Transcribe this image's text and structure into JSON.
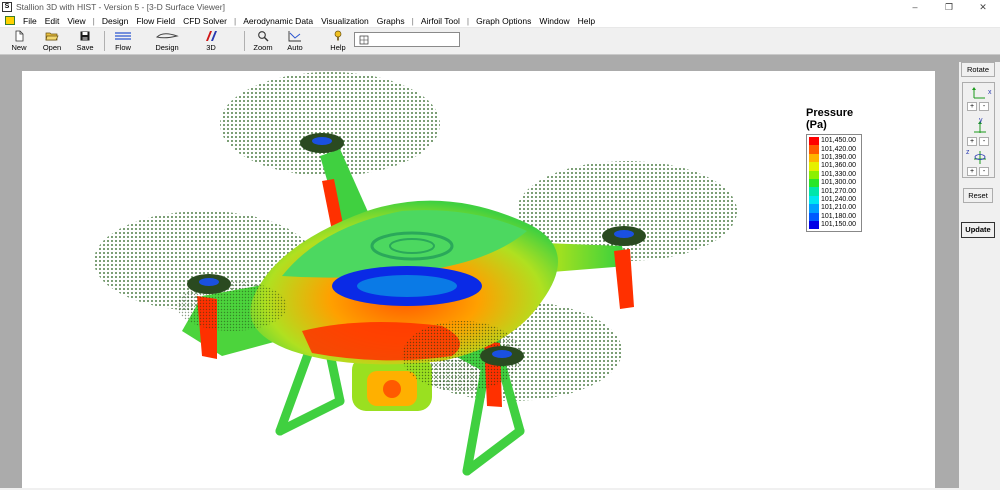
{
  "window": {
    "title": "Stallion 3D with HIST - Version 5 - [3-D Surface Viewer]",
    "minimize": "–",
    "restore": "❐",
    "close": "✕"
  },
  "menu": {
    "items": [
      "File",
      "Edit",
      "View",
      "|",
      "Design",
      "Flow Field",
      "CFD Solver",
      "|",
      "Aerodynamic Data",
      "Visualization",
      "Graphs",
      "|",
      "Airfoil Tool",
      "|",
      "Graph Options",
      "Window",
      "Help"
    ]
  },
  "toolbar": {
    "new_label": "New",
    "open_label": "Open",
    "save_label": "Save",
    "flow_label": "Flow",
    "design_label": "Design",
    "threed_label": "3D",
    "zoom_label": "Zoom",
    "auto_label": "Auto",
    "help_label": "Help"
  },
  "side_panel": {
    "rotate_label": "Rotate",
    "x_axis": "x",
    "y_axis": "y",
    "z_axis": "z",
    "plus": "+",
    "minus": "-",
    "reset_label": "Reset",
    "update_label": "Update"
  },
  "legend": {
    "title": "Pressure (Pa)",
    "entries": [
      {
        "value": "101,450.00",
        "color": "#ff0000"
      },
      {
        "value": "101,420.00",
        "color": "#ff5a00"
      },
      {
        "value": "101,390.00",
        "color": "#ffb400"
      },
      {
        "value": "101,360.00",
        "color": "#e6f000"
      },
      {
        "value": "101,330.00",
        "color": "#8cf000"
      },
      {
        "value": "101,300.00",
        "color": "#28e628"
      },
      {
        "value": "101,270.00",
        "color": "#00e6aa"
      },
      {
        "value": "101,240.00",
        "color": "#00e6f0"
      },
      {
        "value": "101,210.00",
        "color": "#00a0ff"
      },
      {
        "value": "101,180.00",
        "color": "#005aff"
      },
      {
        "value": "101,150.00",
        "color": "#0000e6"
      }
    ]
  },
  "colors": {
    "rotor_disk": "#1e5a14",
    "drone_green": "#3cd23c",
    "drone_red": "#ff2800",
    "drone_blue": "#0028e6"
  }
}
